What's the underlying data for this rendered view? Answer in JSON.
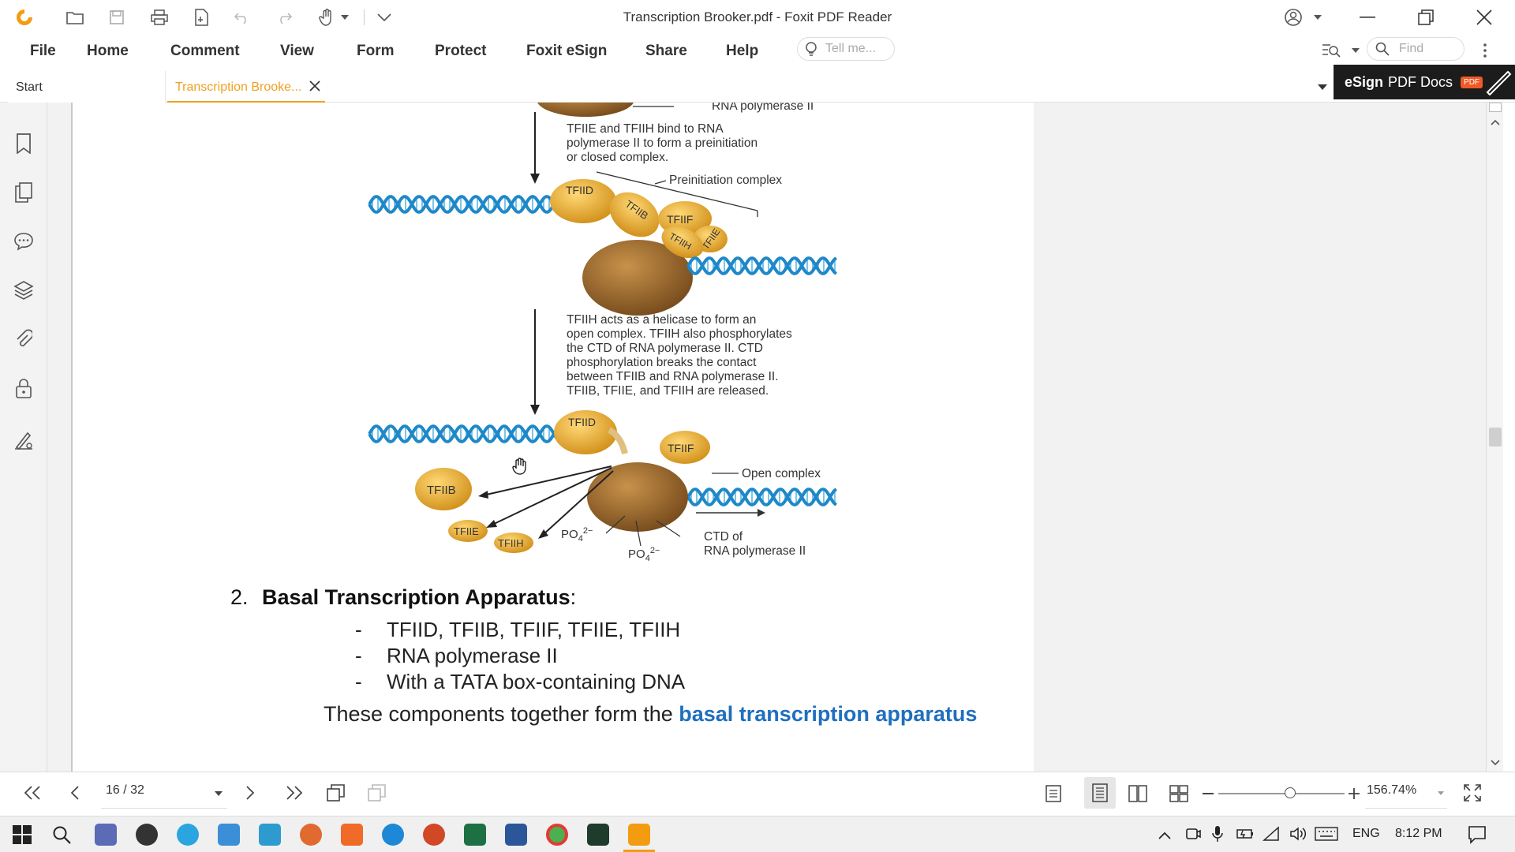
{
  "window": {
    "title": "Transcription Brooker.pdf - Foxit PDF Reader"
  },
  "menu": {
    "items": [
      "File",
      "Home",
      "Comment",
      "View",
      "Form",
      "Protect",
      "Foxit eSign",
      "Share",
      "Help"
    ],
    "tell_me_placeholder": "Tell me...",
    "find_placeholder": "Find"
  },
  "tabs": {
    "start": "Start",
    "active": "Transcription Brooke..."
  },
  "esign_banner": {
    "bold": "eSign",
    "rest": "PDF Docs",
    "badge": "PDF"
  },
  "figure": {
    "label_rnapol_top": "RNA polymerase II",
    "step1": [
      "TFIIE and TFIIH bind to RNA",
      "polymerase II to form a preinitiation",
      "or closed complex."
    ],
    "label_preinit": "Preinitiation complex",
    "step2": [
      "TFIIH acts as a helicase to form an",
      "open complex. TFIIH also phosphorylates",
      "the CTD of RNA polymerase II. CTD",
      "phosphorylation breaks the contact",
      "between TFIIB and RNA polymerase II.",
      "TFIIB, TFIIE, and TFIIH are released."
    ],
    "label_open": "Open complex",
    "label_ctd": [
      "CTD of",
      "RNA polymerase II"
    ],
    "po4": "PO",
    "po4_sub": "4",
    "po4_sup": "2−",
    "factors": {
      "tfiid": "TFIID",
      "tfiib": "TFIIB",
      "tfiif": "TFIIF",
      "tfiie": "TFIIE",
      "tfiih": "TFIIH"
    }
  },
  "content": {
    "heading_num": "2.",
    "heading_text": "Basal Transcription Apparatus",
    "heading_colon": ":",
    "bullets": [
      "TFIID, TFIIB, TFIIF, TFIIE, TFIIH",
      "RNA polymerase II",
      "With a TATA box-containing DNA"
    ],
    "summary_prefix": "These components together form the ",
    "summary_highlight": "basal transcription apparatus"
  },
  "nav": {
    "page_indicator": "16 / 32",
    "zoom": "156.74%"
  },
  "taskbar": {
    "lang": "ENG",
    "time": "8:12 PM"
  },
  "colors": {
    "accent_orange": "#f0a020",
    "link_blue": "#1f6fbf",
    "dna_blue": "#1e88c8",
    "protein_gold": "#e9b032",
    "protein_brown": "#9c6a2a"
  }
}
